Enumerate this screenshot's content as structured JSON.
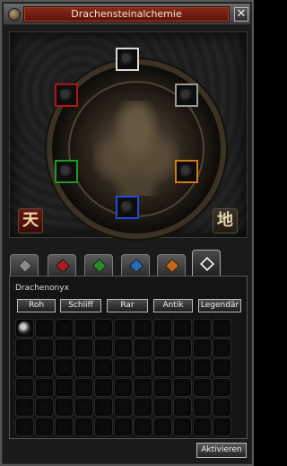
{
  "window": {
    "title": "Drachensteinalchemie",
    "close_symbol": "✕"
  },
  "board": {
    "sky_sign": "天",
    "earth_sign": "地",
    "sockets": [
      {
        "name": "white-socket",
        "color": "#d8d8d8"
      },
      {
        "name": "red-socket",
        "color": "#b01414"
      },
      {
        "name": "black-socket",
        "color": "#9a9a9a"
      },
      {
        "name": "green-socket",
        "color": "#1f9a1f"
      },
      {
        "name": "orange-socket",
        "color": "#d07a18"
      },
      {
        "name": "blue-socket",
        "color": "#1f4fd0"
      }
    ]
  },
  "tabs": [
    {
      "name": "tab-diamond",
      "gem_color": "#8a8a8a",
      "active": false
    },
    {
      "name": "tab-ruby",
      "gem_color": "#a81c24",
      "active": false
    },
    {
      "name": "tab-jade",
      "gem_color": "#2a8a2a",
      "active": false
    },
    {
      "name": "tab-sapphire",
      "gem_color": "#2a6ab8",
      "active": false
    },
    {
      "name": "tab-garnet",
      "gem_color": "#c06818",
      "active": false
    },
    {
      "name": "tab-onyx",
      "gem_color": "#ffffff",
      "active": true
    }
  ],
  "panel": {
    "subtitle": "Drachenonyx",
    "grades": [
      "Roh",
      "Schliff",
      "Rar",
      "Antik",
      "Legendär"
    ]
  },
  "inventory": {
    "rows": 6,
    "cols": 11,
    "filled_slots": [
      0
    ]
  },
  "footer": {
    "activate_label": "Aktivieren"
  }
}
